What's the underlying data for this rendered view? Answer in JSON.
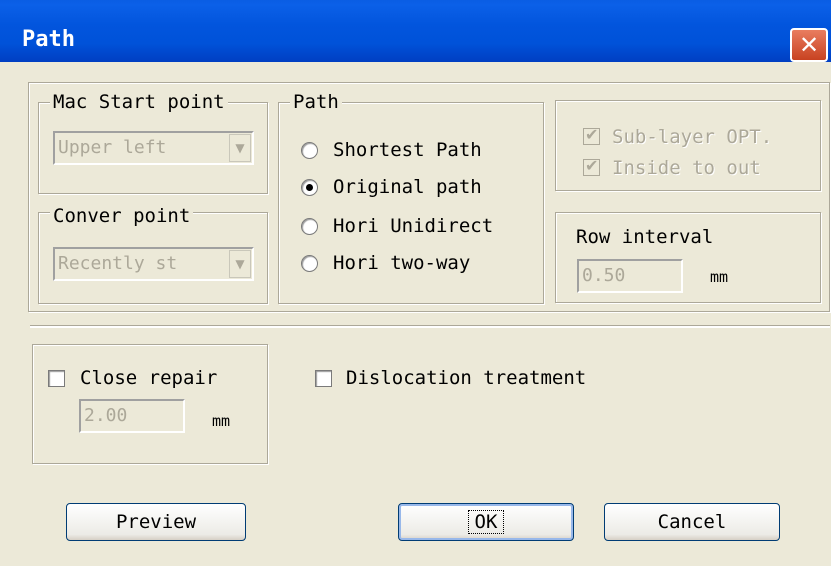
{
  "window": {
    "title": "Path",
    "close_label": "✕"
  },
  "mac_start": {
    "legend": "Mac Start point",
    "value": "Upper left",
    "arrow": "▼"
  },
  "conver": {
    "legend": "Conver point",
    "value": "Recently st",
    "arrow": "▼"
  },
  "path_group": {
    "legend": "Path",
    "options": [
      {
        "label": "Shortest Path",
        "selected": false
      },
      {
        "label": "Original path",
        "selected": true
      },
      {
        "label": "Hori Unidirect",
        "selected": false
      },
      {
        "label": "Hori two-way",
        "selected": false
      }
    ]
  },
  "options_group": {
    "sublayer": {
      "label": "Sub-layer OPT.",
      "checked": true,
      "enabled": false
    },
    "inside_out": {
      "label": "Inside to out",
      "checked": true,
      "enabled": false
    },
    "check_mark": "✔"
  },
  "row_interval": {
    "label": "Row interval",
    "value": "0.50",
    "unit": "mm"
  },
  "close_repair": {
    "label": "Close repair",
    "checked": false,
    "value": "2.00",
    "unit": "mm"
  },
  "dislocation": {
    "label": "Dislocation treatment",
    "checked": false
  },
  "buttons": {
    "preview": "Preview",
    "ok": "OK",
    "cancel": "Cancel"
  }
}
